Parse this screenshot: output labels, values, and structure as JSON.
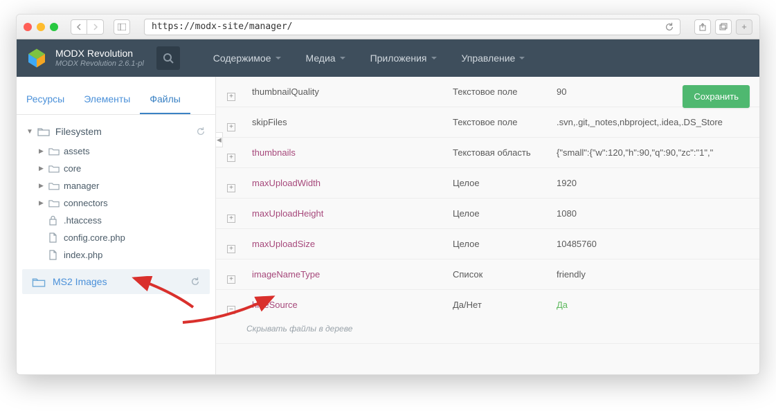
{
  "browser": {
    "url": "https://modx-site/manager/"
  },
  "brand": {
    "title": "MODX Revolution",
    "sub": "MODX Revolution 2.6.1-pl"
  },
  "menu": [
    "Содержимое",
    "Медиа",
    "Приложения",
    "Управление"
  ],
  "sidebar": {
    "tabs": [
      "Ресурсы",
      "Элементы",
      "Файлы"
    ],
    "active_tab": 2,
    "root": "Filesystem",
    "nodes": [
      {
        "t": "folder",
        "name": "assets"
      },
      {
        "t": "folder",
        "name": "core"
      },
      {
        "t": "folder",
        "name": "manager"
      },
      {
        "t": "folder",
        "name": "connectors"
      },
      {
        "t": "lock",
        "name": ".htaccess"
      },
      {
        "t": "file",
        "name": "config.core.php"
      },
      {
        "t": "file",
        "name": "index.php"
      }
    ],
    "ms2": "MS2 Images"
  },
  "save_label": "Сохранить",
  "rows": [
    {
      "name": "thumbnailQuality",
      "link": false,
      "type": "Текстовое поле",
      "value": "90",
      "exp": "plus"
    },
    {
      "name": "skipFiles",
      "link": false,
      "type": "Текстовое поле",
      "value": ".svn,.git,_notes,nbproject,.idea,.DS_Store",
      "exp": "plus"
    },
    {
      "name": "thumbnails",
      "link": true,
      "type": "Текстовая область",
      "value": "{\"small\":{\"w\":120,\"h\":90,\"q\":90,\"zc\":\"1\",\"",
      "exp": "plus"
    },
    {
      "name": "maxUploadWidth",
      "link": true,
      "type": "Целое",
      "value": "1920",
      "exp": "plus"
    },
    {
      "name": "maxUploadHeight",
      "link": true,
      "type": "Целое",
      "value": "1080",
      "exp": "plus"
    },
    {
      "name": "maxUploadSize",
      "link": true,
      "type": "Целое",
      "value": "10485760",
      "exp": "plus"
    },
    {
      "name": "imageNameType",
      "link": true,
      "type": "Список",
      "value": "friendly",
      "exp": "plus"
    },
    {
      "name": "hideSource",
      "link": true,
      "type": "Да/Нет",
      "value": "Да",
      "value_green": true,
      "exp": "minus",
      "desc": "Скрывать файлы в дереве"
    }
  ]
}
